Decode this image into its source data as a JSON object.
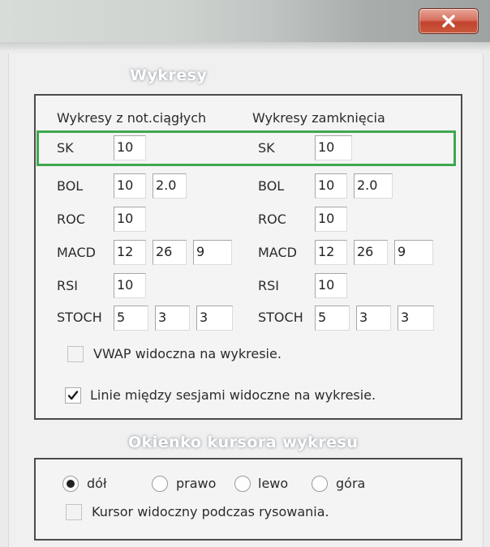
{
  "window": {
    "close_icon": "close-icon"
  },
  "charts_section": {
    "title": "Wykresy",
    "left_heading": "Wykresy z not.ciągłych",
    "right_heading": "Wykresy zamknięcia",
    "left": {
      "sk": {
        "label": "SK",
        "values": [
          "10"
        ]
      },
      "bol": {
        "label": "BOL",
        "values": [
          "10",
          "2.0"
        ]
      },
      "roc": {
        "label": "ROC",
        "values": [
          "10"
        ]
      },
      "macd": {
        "label": "MACD",
        "values": [
          "12",
          "26",
          "9"
        ]
      },
      "rsi": {
        "label": "RSI",
        "values": [
          "10"
        ]
      },
      "stoch": {
        "label": "STOCH",
        "values": [
          "5",
          "3",
          "3"
        ]
      }
    },
    "right": {
      "sk": {
        "label": "SK",
        "values": [
          "10"
        ]
      },
      "bol": {
        "label": "BOL",
        "values": [
          "10",
          "2.0"
        ]
      },
      "roc": {
        "label": "ROC",
        "values": [
          "10"
        ]
      },
      "macd": {
        "label": "MACD",
        "values": [
          "12",
          "26",
          "9"
        ]
      },
      "rsi": {
        "label": "RSI",
        "values": [
          "10"
        ]
      },
      "stoch": {
        "label": "STOCH",
        "values": [
          "5",
          "3",
          "3"
        ]
      }
    },
    "vwap": {
      "label": "VWAP widoczna na wykresie.",
      "checked": false
    },
    "session_lines": {
      "label": "Linie między sesjami widoczne na wykresie.",
      "checked": true
    }
  },
  "cursor_section": {
    "title": "Okienko kursora wykresu",
    "options": [
      {
        "label": "dół",
        "selected": true
      },
      {
        "label": "prawo",
        "selected": false
      },
      {
        "label": "lewo",
        "selected": false
      },
      {
        "label": "góra",
        "selected": false
      }
    ],
    "cursor_visible": {
      "label": "Kursor widoczny podczas rysowania.",
      "checked": false
    }
  },
  "colors": {
    "highlight": "#3fa84f",
    "close_button": "#c3432e"
  }
}
